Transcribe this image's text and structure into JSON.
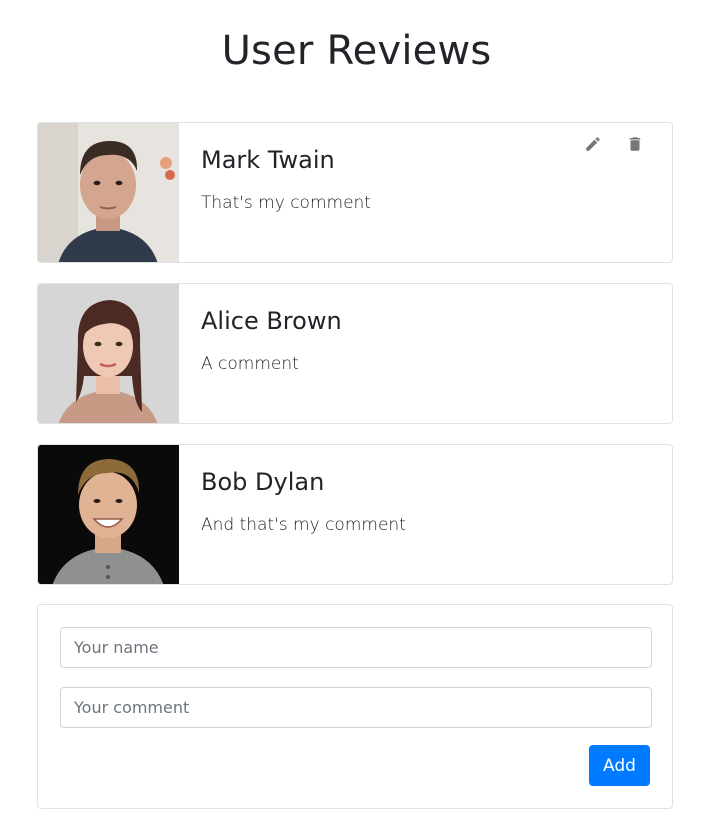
{
  "page": {
    "title": "User Reviews"
  },
  "reviews": [
    {
      "name": "Mark Twain",
      "comment": "That's my comment"
    },
    {
      "name": "Alice Brown",
      "comment": "A comment"
    },
    {
      "name": "Bob Dylan",
      "comment": "And that's my comment"
    }
  ],
  "icons": {
    "edit": "pencil-icon",
    "delete": "trash-icon"
  },
  "form": {
    "name_placeholder": "Your name",
    "comment_placeholder": "Your comment",
    "add_label": "Add"
  },
  "colors": {
    "primary": "#007bff",
    "border": "#dee2e6",
    "icon": "#777777"
  }
}
